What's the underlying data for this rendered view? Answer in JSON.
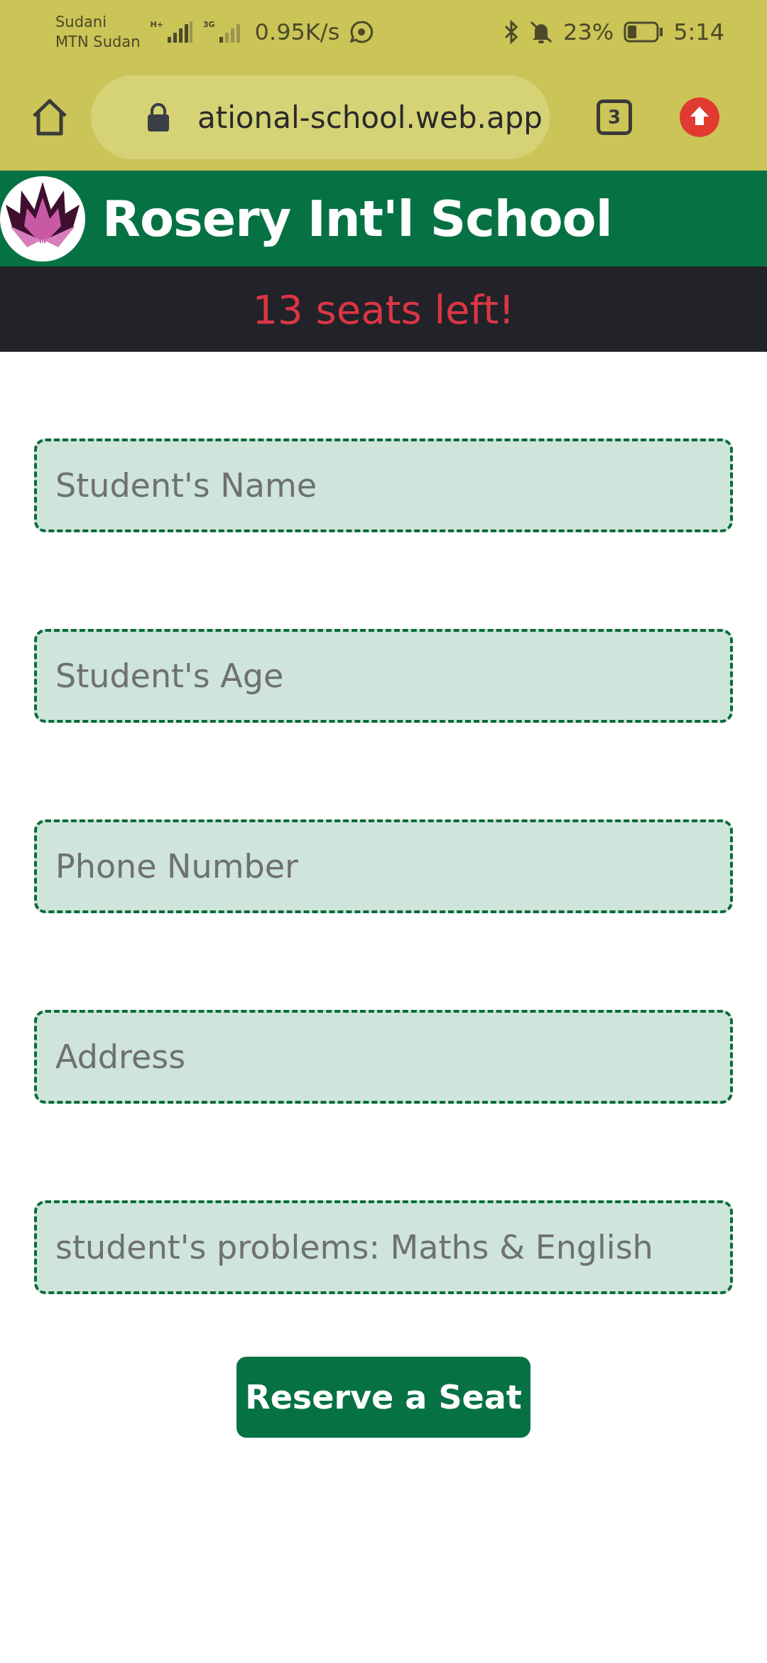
{
  "status_bar": {
    "carrier_1": "Sudani",
    "carrier_2": "MTN Sudan",
    "network_1": "H+",
    "network_2": "3G",
    "speed": "0.95K/s",
    "battery": "23%",
    "time": "5:14"
  },
  "browser": {
    "url": "ational-school.web.app",
    "tab_count": "3"
  },
  "header": {
    "title": "Rosery Int'l School"
  },
  "banner": {
    "text": "13 seats left!"
  },
  "form": {
    "fields": [
      {
        "placeholder": "Student's Name"
      },
      {
        "placeholder": "Student's Age"
      },
      {
        "placeholder": "Phone Number"
      },
      {
        "placeholder": "Address"
      },
      {
        "placeholder": "student's problems: Maths & English"
      }
    ],
    "submit": "Reserve a Seat"
  }
}
